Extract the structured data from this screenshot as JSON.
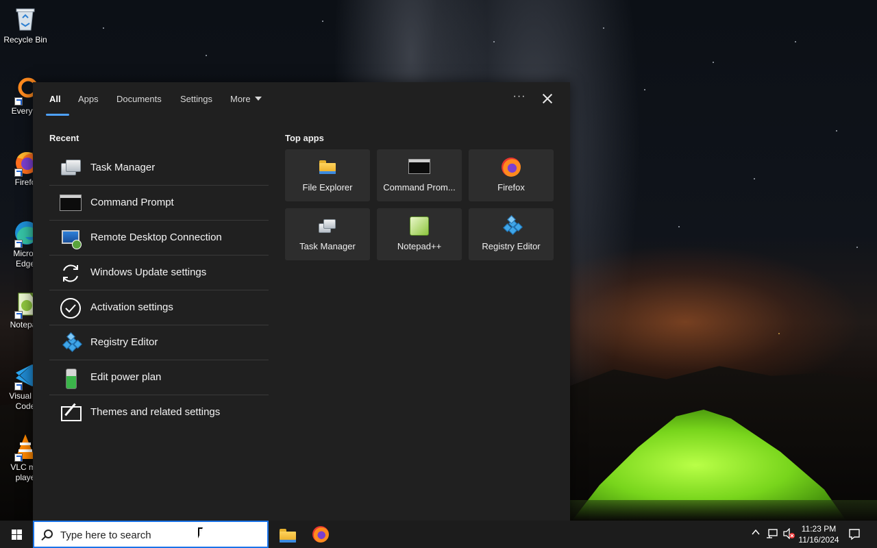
{
  "desktop": {
    "icons": [
      {
        "label": "Recycle Bin",
        "icon": "recycle-bin-icon"
      },
      {
        "label": "Everyth",
        "icon": "everything-search-icon"
      },
      {
        "label": "Firefo",
        "icon": "firefox-icon"
      },
      {
        "label": "Micros\nEdge",
        "icon": "edge-icon"
      },
      {
        "label": "Notepac",
        "icon": "notepad-plus-plus-icon"
      },
      {
        "label": "Visual St\nCode",
        "icon": "vscode-icon"
      },
      {
        "label": "VLC me\nplaye",
        "icon": "vlc-icon"
      }
    ]
  },
  "search": {
    "tabs": [
      {
        "label": "All",
        "active": true
      },
      {
        "label": "Apps"
      },
      {
        "label": "Documents"
      },
      {
        "label": "Settings"
      },
      {
        "label": "More"
      }
    ],
    "more_options_label": "···",
    "recent_title": "Recent",
    "recent": [
      {
        "label": "Task Manager",
        "icon": "task-manager-icon"
      },
      {
        "label": "Command Prompt",
        "icon": "command-prompt-icon"
      },
      {
        "label": "Remote Desktop Connection",
        "icon": "remote-desktop-icon"
      },
      {
        "label": "Windows Update settings",
        "icon": "refresh-icon"
      },
      {
        "label": "Activation settings",
        "icon": "checkmark-circle-icon"
      },
      {
        "label": "Registry Editor",
        "icon": "registry-editor-icon"
      },
      {
        "label": "Edit power plan",
        "icon": "battery-icon"
      },
      {
        "label": "Themes and related settings",
        "icon": "theme-brush-icon"
      }
    ],
    "top_apps_title": "Top apps",
    "top_apps": [
      {
        "label": "File Explorer",
        "icon": "folder-icon"
      },
      {
        "label": "Command Prom...",
        "icon": "command-prompt-icon"
      },
      {
        "label": "Firefox",
        "icon": "firefox-icon"
      },
      {
        "label": "Task Manager",
        "icon": "task-manager-icon"
      },
      {
        "label": "Notepad++",
        "icon": "notepad-plus-plus-icon"
      },
      {
        "label": "Registry Editor",
        "icon": "registry-editor-icon"
      }
    ]
  },
  "taskbar": {
    "search_placeholder": "Type here to search",
    "pinned": [
      {
        "label": "File Explorer",
        "icon": "folder-icon"
      },
      {
        "label": "Firefox",
        "icon": "firefox-icon"
      }
    ],
    "time": "11:23 PM",
    "date": "11/16/2024"
  },
  "colors": {
    "accent": "#4ea1ff",
    "flyout_bg": "#202020",
    "tile_bg": "#2d2d2d",
    "taskbar_bg": "#1c1c1c",
    "search_border": "#1a73e8"
  }
}
